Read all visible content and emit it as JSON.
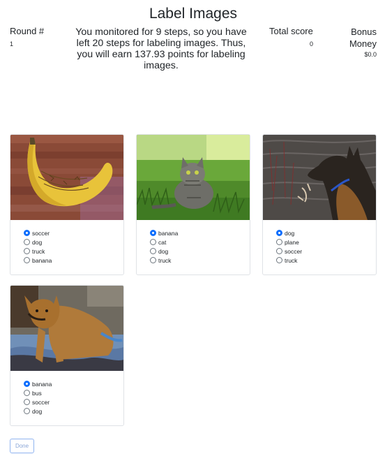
{
  "header": {
    "title": "Label Images",
    "round_label": "Round #",
    "round_value": "1",
    "message": "You monitored for 9 steps, so you have left 20 steps for labeling images. Thus, you will earn 137.93 points for labeling images.",
    "total_score_label": "Total score",
    "total_score_value": "0",
    "bonus_label": "Bonus Money",
    "bonus_value": "$0.0"
  },
  "cards": [
    {
      "image": "banana-photo",
      "options": [
        "soccer",
        "dog",
        "truck",
        "banana"
      ],
      "selected": "soccer"
    },
    {
      "image": "cat-photo",
      "options": [
        "banana",
        "cat",
        "dog",
        "truck"
      ],
      "selected": "banana"
    },
    {
      "image": "dog-by-water-photo",
      "options": [
        "dog",
        "plane",
        "soccer",
        "truck"
      ],
      "selected": "dog"
    },
    {
      "image": "dog-on-bed-photo",
      "options": [
        "banana",
        "bus",
        "soccer",
        "dog"
      ],
      "selected": "banana"
    }
  ],
  "done_label": "Done",
  "colors": {
    "accent": "#0d6efd",
    "card_border": "#dfe2e6"
  }
}
